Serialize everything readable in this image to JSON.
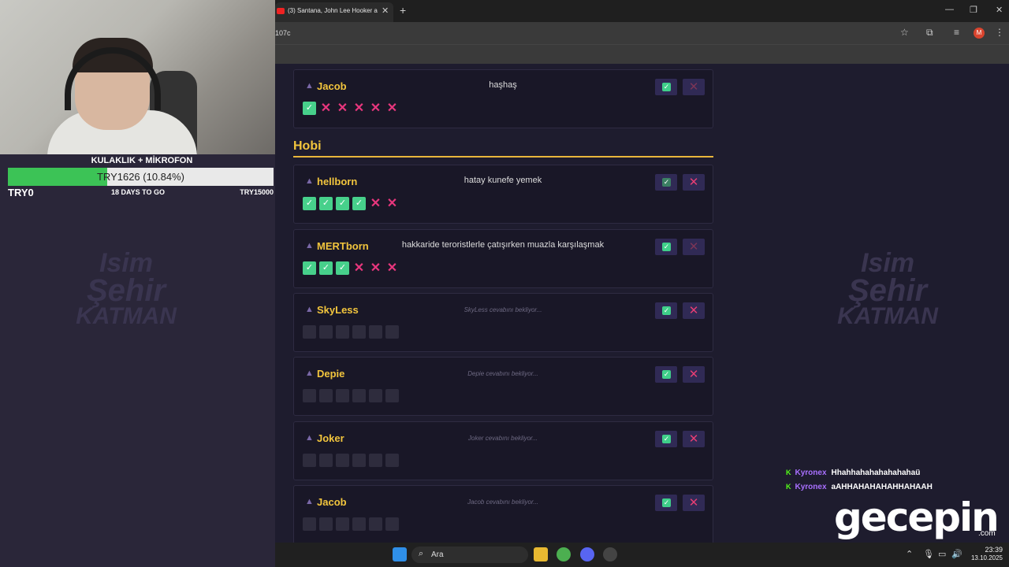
{
  "overlay": {
    "goal_title": "KULAKLIK + MİKROFON",
    "goal_progress_text": "TRY1626 (10.84%)",
    "goal_progress_fraction": 0.1084,
    "goal_start": "TRY0",
    "goal_days": "18 DAYS TO GO",
    "goal_end": "TRY15000",
    "watermark": {
      "line1": "Isim",
      "line2": "Şehir",
      "line3": "KATMAN"
    }
  },
  "browser": {
    "tab_title": "(3) Santana, John Lee Hooker a",
    "url": "107c"
  },
  "game": {
    "top_card": {
      "name": "Jacob",
      "answer": "haşhaş",
      "votes": [
        "yes",
        "no",
        "no",
        "no",
        "no",
        "no"
      ]
    },
    "section_title": "Hobi",
    "cards": [
      {
        "name": "hellborn",
        "answer": "hatay kunefe yemek",
        "waiting": false,
        "votes": [
          "yes",
          "yes",
          "yes",
          "yes",
          "no",
          "no"
        ]
      },
      {
        "name": "MERTborn",
        "answer": "hakkaride teroristlerle çatışırken muazla karşılaşmak",
        "waiting": false,
        "votes": [
          "yes",
          "yes",
          "yes",
          "no",
          "no",
          "no"
        ]
      },
      {
        "name": "SkyLess",
        "answer": "SkyLess cevabını bekliyor...",
        "waiting": true,
        "votes": [
          "empty",
          "empty",
          "empty",
          "empty",
          "empty",
          "empty"
        ]
      },
      {
        "name": "Depie",
        "answer": "Depie cevabını bekliyor...",
        "waiting": true,
        "votes": [
          "empty",
          "empty",
          "empty",
          "empty",
          "empty",
          "empty"
        ]
      },
      {
        "name": "Joker",
        "answer": "Joker cevabını bekliyor...",
        "waiting": true,
        "votes": [
          "empty",
          "empty",
          "empty",
          "empty",
          "empty",
          "empty"
        ]
      },
      {
        "name": "Jacob",
        "answer": "Jacob cevabını bekliyor...",
        "waiting": true,
        "votes": [
          "empty",
          "empty",
          "empty",
          "empty",
          "empty",
          "empty"
        ]
      }
    ]
  },
  "chat": [
    {
      "user": "Kyronex",
      "message": "Hhahhahahahahahahaü"
    },
    {
      "user": "Kyronex",
      "message": "aAHHAHAHAHAHHAHAAH"
    }
  ],
  "logo": {
    "text": "gecepin",
    "suffix": ".com"
  },
  "taskbar": {
    "search_label": "Ara",
    "time": "23:39",
    "date": "13.10.2025"
  },
  "icons": {
    "person": "person-icon",
    "check": "check-icon",
    "cross": "cross-icon",
    "search": "search-icon",
    "star": "star-icon",
    "extensions": "puzzle-icon"
  },
  "colors": {
    "accent_yellow": "#f2c53d",
    "check_green": "#47d08b",
    "cross_pink": "#e8367d",
    "goal_green": "#3cc356",
    "kick_green": "#53fc18",
    "chat_user": "#a970ff"
  }
}
